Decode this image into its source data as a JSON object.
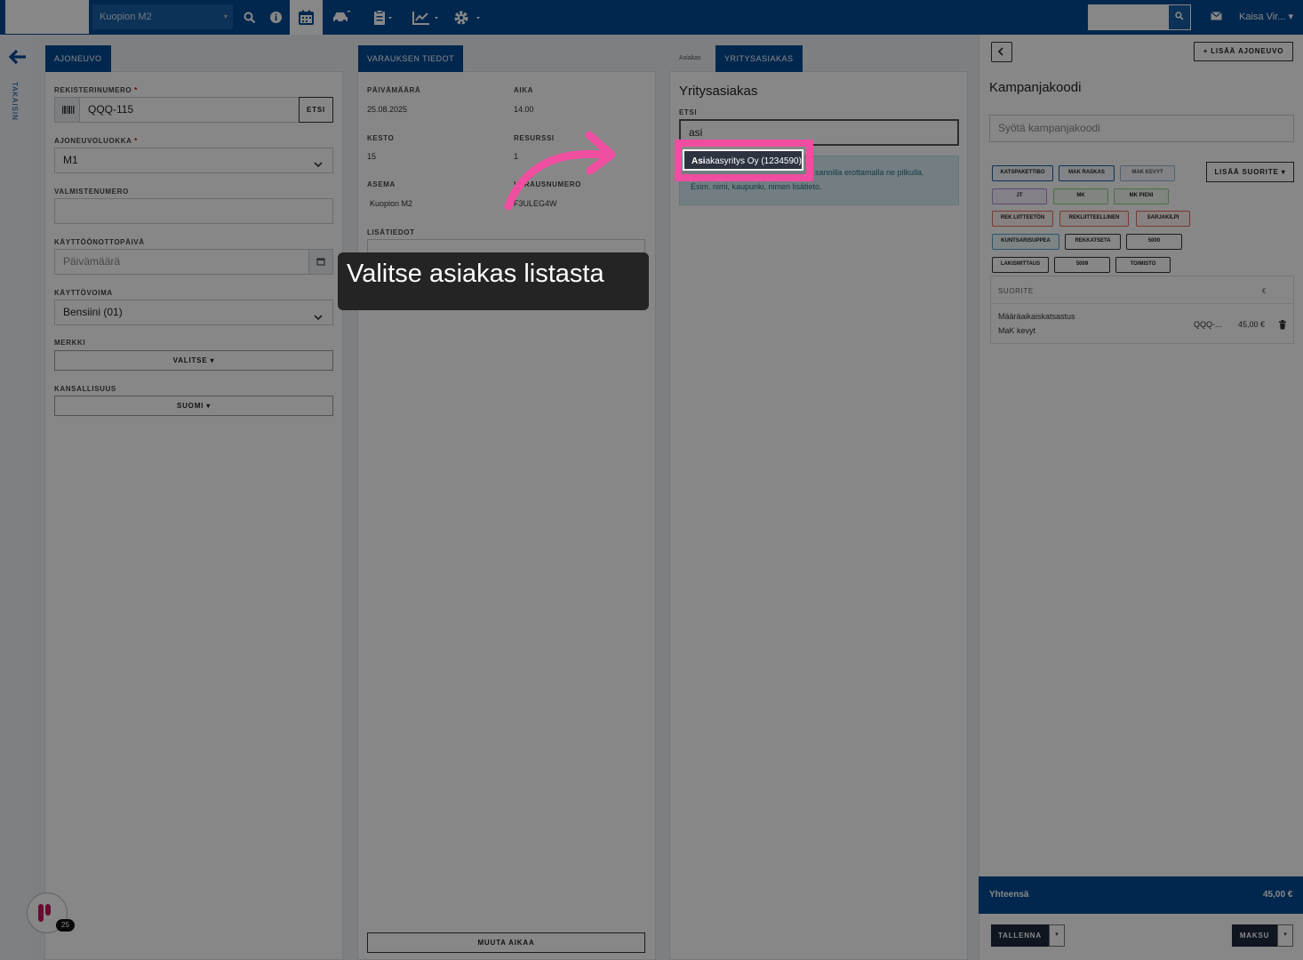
{
  "topbar": {
    "location": "Kuopion M2",
    "user": "Kaisa Vir...",
    "search_placeholder": "",
    "search_icon": "search-icon"
  },
  "rail": {
    "back_label": "TAKAISIN"
  },
  "vehicle": {
    "tab": "AJONEUVO",
    "reg_label": "REKISTERINUMERO",
    "required_mark": "*",
    "reg_value": "QQQ-115",
    "reg_search": "ETSI",
    "class_label": "AJONEUVOLUOKKA",
    "class_value": "M1",
    "vin_label": "VALMISTENUMERO",
    "vin_value": "",
    "first_reg_label": "KÄYTTÖÖNOTTOPÄIVÄ",
    "first_reg_placeholder": "Päivämäärä",
    "fuel_label": "KÄYTTÖVOIMA",
    "fuel_value": "Bensiini (01)",
    "make_label": "MERKKI",
    "make_value": "VALITSE",
    "nationality_label": "KANSALLISUUS",
    "nationality_value": "SUOMI"
  },
  "booking": {
    "tab": "VARAUKSEN TIEDOT",
    "date_label": "PÄIVÄMÄÄRÄ",
    "date_value": "25.08.2025",
    "time_label": "AIKA",
    "time_value": "14.00",
    "duration_label": "KESTO",
    "duration_value": "15",
    "resource_label": "RESURSSI",
    "resource_value": "1",
    "station_label": "ASEMA",
    "station_value": "Kuopion M2",
    "booking_no_label": "VARAUSNUMERO",
    "booking_no_value": "F3ULEG4W",
    "notes_label": "LISÄTIEDOT",
    "change_time": "MUUTA AIKAA"
  },
  "customer": {
    "tab_inactive": "Asiakas",
    "tab_active": "YRITYSASIAKAS",
    "title": "Yritysasiakas",
    "search_label": "ETSI",
    "search_value": "asi",
    "hint_line1": "sanoilla erottamalla ne pilkulla.",
    "hint_line2": "Esim. nimi, kaupunki, nimen lisätieto.",
    "result_match": "Asi",
    "result_rest": "akasyritys Oy (1234590)"
  },
  "right": {
    "add_vehicle": "LISÄÄ AJONEUVO",
    "campaign_title": "Kampanjakoodi",
    "campaign_placeholder": "Syötä kampanjakoodi",
    "add_service": "LISÄÄ SUORITE",
    "chips": [
      "KATSPAKETTIBO",
      "MAK RASKAS",
      "MAK KEVYT",
      "JT",
      "MK",
      "MK PIENI",
      "REK LIITTEETÖN",
      "REKLIITTEELLINEN",
      "SARJAKILPI",
      "KUNTSARISUPPEA",
      "REKKATSETA",
      "5000",
      "LAKISMITTAUS",
      "5009",
      "TOIMISTO"
    ],
    "table_header": "SUORITE",
    "currency": "€",
    "row_service": "Määräaikaiskatsastus",
    "row_sub": "MaK kevyt",
    "row_reg": "QQQ-...",
    "row_price": "45,00 €",
    "total_label": "Yhteensä",
    "total_value": "45,00 €",
    "save": "TALLENNA",
    "pay": "MAKSU"
  },
  "tooltip": {
    "text": "Valitse asiakas listasta"
  },
  "notifications": {
    "count": "25"
  },
  "colors": {
    "primary": "#054a93",
    "highlight": "#ef4da0"
  }
}
